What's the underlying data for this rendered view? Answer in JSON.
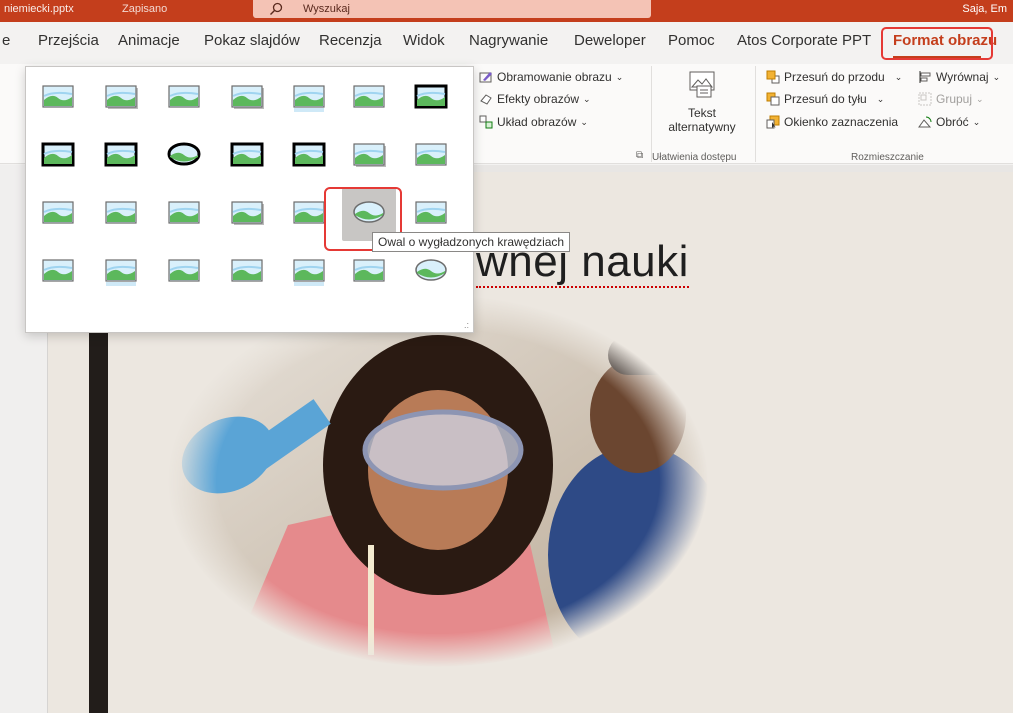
{
  "titlebar": {
    "filename": "niemiecki.pptx",
    "saved_status": "Zapisano",
    "search_placeholder": "Wyszukaj",
    "user": "Saja, Em"
  },
  "tabs": [
    {
      "label": "e"
    },
    {
      "label": "Przejścia"
    },
    {
      "label": "Animacje"
    },
    {
      "label": "Pokaz slajdów"
    },
    {
      "label": "Recenzja"
    },
    {
      "label": "Widok"
    },
    {
      "label": "Nagrywanie"
    },
    {
      "label": "Deweloper"
    },
    {
      "label": "Pomoc"
    },
    {
      "label": "Atos Corporate PPT"
    },
    {
      "label": "Format obrazu",
      "active": true
    }
  ],
  "ribbon": {
    "picture_border": "Obramowanie obrazu",
    "picture_effects": "Efekty obrazów",
    "picture_layout": "Układ obrazów",
    "alt_text_line1": "Tekst",
    "alt_text_line2": "alternatywny",
    "accessibility_group": "Ułatwienia dostępu",
    "bring_forward": "Przesuń do przodu",
    "send_backward": "Przesuń do tyłu",
    "selection_pane": "Okienko zaznaczenia",
    "align": "Wyrównaj",
    "group": "Grupuj",
    "rotate": "Obróć",
    "arrange_group": "Rozmieszczanie"
  },
  "gallery": {
    "tooltip": "Owal o wygładzonych krawędziach",
    "hovered_index": 19,
    "items": [
      "simple-frame",
      "simple-shadow",
      "beveled-matte",
      "drop-shadow-rect",
      "reflected-rounded",
      "soft-edge-rect",
      "double-frame-black",
      "thick-matte-black",
      "simple-frame-black",
      "beveled-oval-black",
      "compound-frame-black",
      "moderate-frame-black",
      "center-shadow",
      "rounded-diagonal",
      "snip-diagonal",
      "moderate-frame-white",
      "rotated-white",
      "perspective-shadow",
      "relaxed-perspective",
      "soft-edge-oval",
      "bevel-rectangle",
      "perspective-left",
      "reflected-perspective",
      "bevel-perspective",
      "metal-frame",
      "reflected-bevel",
      "metal-rounded",
      "metal-oval"
    ]
  },
  "slide": {
    "title_visible": "wnej nauki",
    "image_alt": "Girl in safety goggles doing a chemistry experiment"
  },
  "colors": {
    "accent": "#c43e1c",
    "highlight": "#e53935"
  }
}
